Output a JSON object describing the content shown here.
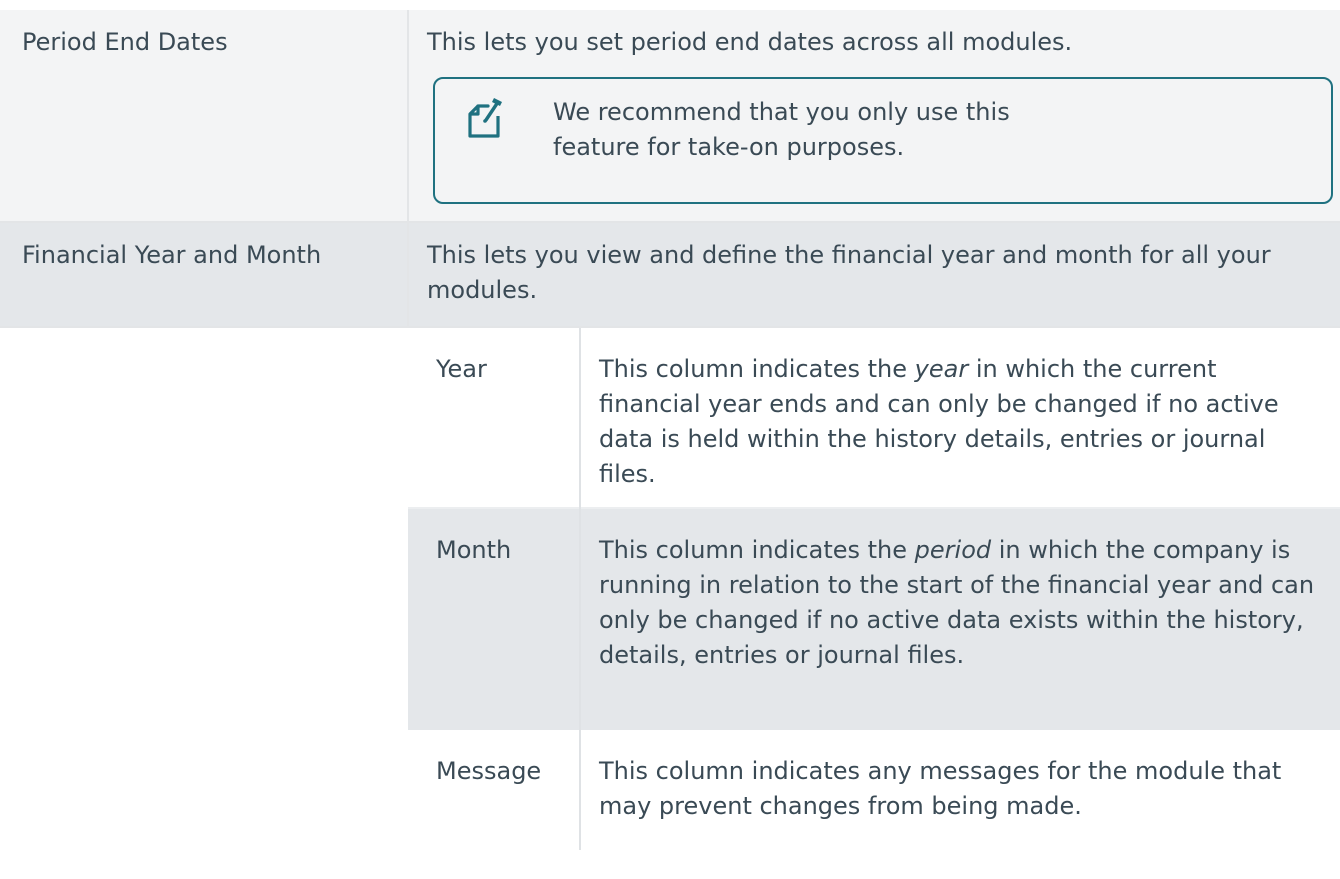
{
  "rows": [
    {
      "label": "Period End Dates",
      "description": "This lets you set period end dates across all modules.",
      "note": {
        "icon": "note-edit-icon",
        "text": "We recommend that you only use this feature for take-on purposes.",
        "border_color": "#1f7180"
      }
    },
    {
      "label": "Financial Year and Month",
      "description": "This lets you view and define the financial year and month for all your modules."
    }
  ],
  "subtable": [
    {
      "key": "Year",
      "pre": "This column indicates the ",
      "emph": "year",
      "post": " in which the current financial year ends and can only be changed if no active data is held within the history details, entries or journal files."
    },
    {
      "key": "Month",
      "pre": "This column indicates the ",
      "emph": "period",
      "post": " in which the company is running in relation to the start of the financial year and can only be changed if no active data exists within the history, details, entries or journal files."
    },
    {
      "key": "Message",
      "text": "This column indicates any messages for the module that may prevent changes from being made."
    }
  ]
}
